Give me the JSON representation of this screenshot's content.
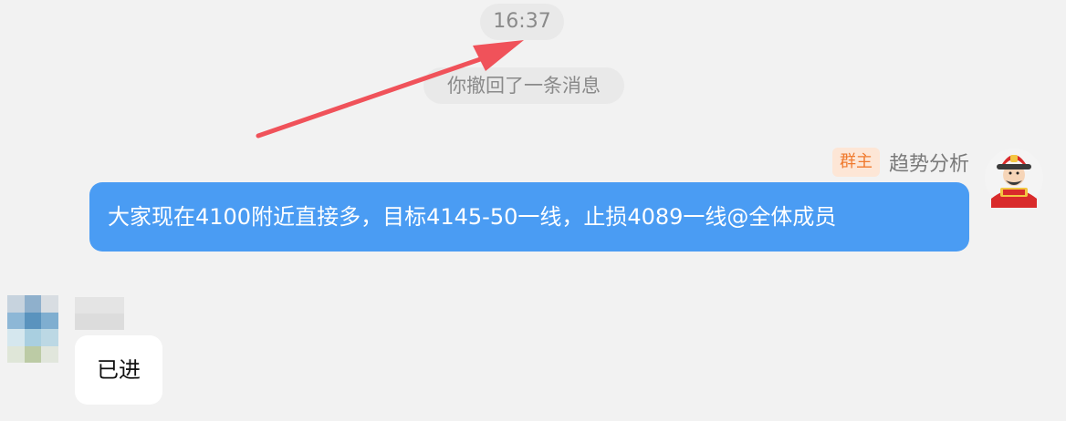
{
  "chat": {
    "timestamp": "16:37",
    "recall_notice": "你撤回了一条消息",
    "messages": [
      {
        "side": "right",
        "sender_role": "群主",
        "sender_name": "趋势分析",
        "text": "大家现在4100附近直接多，目标4145-50一线，止损4089一线@全体成员",
        "bubble_color": "#4a9cf3"
      },
      {
        "side": "left",
        "text": "已进",
        "bubble_color": "#ffffff"
      }
    ]
  },
  "colors": {
    "background": "#f2f2f2",
    "annotation_arrow": "#f0525a",
    "badge_text": "#f07a2e",
    "badge_bg": "#fde6d6"
  },
  "icons": {
    "right_avatar": "caishen-avatar-icon",
    "left_avatar": "blurred-avatar-icon"
  }
}
